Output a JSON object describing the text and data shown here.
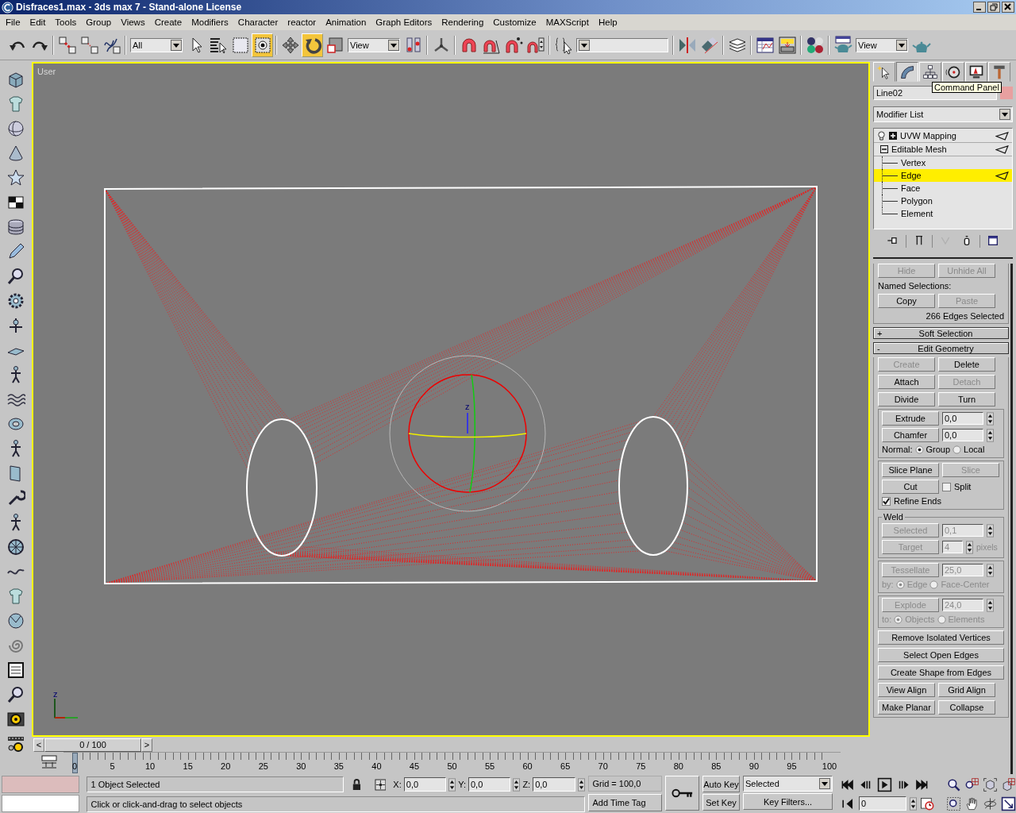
{
  "window": {
    "title": "Disfraces1.max - 3ds max 7  - Stand-alone License"
  },
  "menu": [
    "File",
    "Edit",
    "Tools",
    "Group",
    "Views",
    "Create",
    "Modifiers",
    "Character",
    "reactor",
    "Animation",
    "Graph Editors",
    "Rendering",
    "Customize",
    "MAXScript",
    "Help"
  ],
  "toolbar": [
    {
      "kind": "undo",
      "active": false
    },
    {
      "kind": "redo",
      "active": false
    },
    {
      "kind": "sep"
    },
    {
      "kind": "link",
      "active": false
    },
    {
      "kind": "unlink",
      "active": false
    },
    {
      "kind": "bind",
      "active": false
    },
    {
      "kind": "sep"
    },
    {
      "kind": "dropdown",
      "value": "All"
    },
    {
      "kind": "select",
      "active": false
    },
    {
      "kind": "select_by_name",
      "active": false
    },
    {
      "kind": "region",
      "active": false
    },
    {
      "kind": "crossing",
      "active": true
    },
    {
      "kind": "sep"
    },
    {
      "kind": "move",
      "active": false
    },
    {
      "kind": "rotate",
      "active": true
    },
    {
      "kind": "scale",
      "active": false
    },
    {
      "kind": "dropdown",
      "value": "View"
    },
    {
      "kind": "pivot",
      "active": false
    },
    {
      "kind": "sep"
    },
    {
      "kind": "manipulate",
      "active": false
    },
    {
      "kind": "sep"
    },
    {
      "kind": "snap",
      "active": false
    },
    {
      "kind": "angle_snap",
      "active": false
    },
    {
      "kind": "percent_snap",
      "active": false
    },
    {
      "kind": "spinner_snap",
      "active": false
    },
    {
      "kind": "sep"
    },
    {
      "kind": "edit_named",
      "active": false
    },
    {
      "kind": "dropdown"
    },
    {
      "kind": "sep"
    },
    {
      "kind": "mirror",
      "active": false
    },
    {
      "kind": "align",
      "active": false
    },
    {
      "kind": "sep"
    },
    {
      "kind": "layers",
      "active": false
    },
    {
      "kind": "sep"
    },
    {
      "kind": "curve_editor",
      "active": false
    },
    {
      "kind": "schematic",
      "active": false
    },
    {
      "kind": "sep"
    },
    {
      "kind": "material",
      "active": false
    },
    {
      "kind": "sep"
    },
    {
      "kind": "render_scene",
      "active": false
    },
    {
      "kind": "dropdown",
      "value": "View"
    },
    {
      "kind": "quick_render",
      "active": false
    }
  ],
  "viewport": {
    "label": "User",
    "gizmo_axis": "z",
    "tripod_axis": "z"
  },
  "time_slider": {
    "prev": "<",
    "position": "0 / 100",
    "next": ">",
    "level": 0
  },
  "track_bar": {
    "ticks": [
      "0",
      "5",
      "10",
      "15",
      "20",
      "25",
      "30",
      "35",
      "40",
      "45",
      "50",
      "55",
      "60",
      "65",
      "70",
      "75",
      "80",
      "85",
      "90",
      "95",
      "100"
    ]
  },
  "command_panel": {
    "tabs": [
      {
        "kind": "create",
        "selected": false
      },
      {
        "kind": "modify",
        "selected": true
      },
      {
        "kind": "hierarchy",
        "selected": false
      },
      {
        "kind": "motion",
        "selected": false
      },
      {
        "kind": "display",
        "selected": false
      },
      {
        "kind": "utilities",
        "selected": false
      }
    ],
    "tooltip": "Command Panel",
    "object_name": "Line02",
    "modifier_list": "Modifier List",
    "stack": [
      {
        "label": "UVW Mapping",
        "expanded": false
      },
      {
        "label": "Editable Mesh",
        "expanded": true,
        "children": [
          {
            "label": "Vertex",
            "selected": false
          },
          {
            "label": "Edge",
            "selected": true
          },
          {
            "label": "Face",
            "selected": false
          },
          {
            "label": "Polygon",
            "selected": false
          },
          {
            "label": "Element",
            "selected": false
          }
        ]
      }
    ],
    "stack_tools": [
      {
        "kind": "pin",
        "disabled": false
      },
      {
        "kind": "end_result",
        "disabled": false
      },
      {
        "kind": "unique",
        "disabled": true
      },
      {
        "kind": "remove",
        "disabled": false
      },
      {
        "kind": "configure",
        "disabled": false
      }
    ],
    "rollouts": [
      {
        "groups": [
          {
            "framed": false,
            "rows": [
              {
                "kind": "buttons",
                "buttons": [
                  {
                    "label": "Hide",
                    "disabled": true
                  },
                  {
                    "label": "Unhide All",
                    "disabled": true
                  }
                ]
              },
              {
                "kind": "heading",
                "text": "Named Selections:"
              },
              {
                "kind": "buttons",
                "buttons": [
                  {
                    "label": "Copy",
                    "disabled": false
                  },
                  {
                    "label": "Paste",
                    "disabled": true
                  }
                ]
              },
              {
                "kind": "status",
                "text": "266 Edges Selected"
              }
            ]
          }
        ]
      },
      {
        "sign": "+",
        "header": "Soft Selection"
      },
      {
        "sign": "-",
        "header": "Edit Geometry",
        "groups": [
          {
            "framed": false,
            "rows": [
              {
                "kind": "buttons",
                "buttons": [
                  {
                    "label": "Create",
                    "disabled": true
                  },
                  {
                    "label": "Delete",
                    "disabled": false
                  }
                ]
              },
              {
                "kind": "buttons",
                "buttons": [
                  {
                    "label": "Attach",
                    "disabled": false
                  },
                  {
                    "label": "Detach",
                    "disabled": true
                  }
                ]
              },
              {
                "kind": "buttons",
                "buttons": [
                  {
                    "label": "Divide",
                    "disabled": false
                  },
                  {
                    "label": "Turn",
                    "disabled": false
                  }
                ]
              }
            ]
          },
          {
            "framed": true,
            "rows": [
              {
                "kind": "spinner",
                "button": {
                  "label": "Extrude",
                  "disabled": false
                },
                "value": "0,0"
              },
              {
                "kind": "spinner",
                "button": {
                  "label": "Chamfer",
                  "disabled": false
                },
                "value": "0,0"
              },
              {
                "kind": "radios",
                "label": "Normal:",
                "disabled": false,
                "options": [
                  {
                    "label": "Group",
                    "selected": true
                  },
                  {
                    "label": "Local",
                    "selected": false
                  }
                ]
              }
            ]
          },
          {
            "framed": true,
            "rows": [
              {
                "kind": "buttons",
                "buttons": [
                  {
                    "label": "Slice Plane",
                    "disabled": false
                  },
                  {
                    "label": "Slice",
                    "disabled": true
                  }
                ]
              },
              {
                "kind": "button_check",
                "button": {
                  "label": "Cut",
                  "disabled": false
                },
                "check": {
                  "label": "Split",
                  "checked": false
                }
              },
              {
                "kind": "check",
                "label": "Refine Ends",
                "checked": true
              }
            ]
          },
          {
            "framed": true,
            "title": "Weld",
            "rows": [
              {
                "kind": "spinner",
                "button": {
                  "label": "Selected",
                  "disabled": true
                },
                "value": "0,1"
              },
              {
                "kind": "spinner",
                "button": {
                  "label": "Target",
                  "disabled": true
                },
                "value": "4",
                "unit": "pixels"
              }
            ]
          },
          {
            "framed": true,
            "rows": [
              {
                "kind": "spinner",
                "button": {
                  "label": "Tessellate",
                  "disabled": true
                },
                "value": "25,0"
              },
              {
                "kind": "radios",
                "label": "by:",
                "disabled": true,
                "options": [
                  {
                    "label": "Edge",
                    "selected": true
                  },
                  {
                    "label": "Face-Center",
                    "selected": false
                  }
                ]
              }
            ]
          },
          {
            "framed": true,
            "rows": [
              {
                "kind": "spinner",
                "button": {
                  "label": "Explode",
                  "disabled": true
                },
                "value": "24,0"
              },
              {
                "kind": "radios",
                "label": "to:",
                "disabled": true,
                "options": [
                  {
                    "label": "Objects",
                    "selected": true
                  },
                  {
                    "label": "Elements",
                    "selected": false
                  }
                ]
              }
            ]
          },
          {
            "framed": false,
            "rows": [
              {
                "kind": "buttons",
                "buttons": [
                  {
                    "label": "Remove Isolated Vertices",
                    "disabled": false
                  }
                ]
              },
              {
                "kind": "buttons",
                "buttons": [
                  {
                    "label": "Select Open Edges",
                    "disabled": false
                  }
                ]
              },
              {
                "kind": "buttons",
                "buttons": [
                  {
                    "label": "Create Shape from Edges",
                    "disabled": false
                  }
                ]
              },
              {
                "kind": "buttons",
                "buttons": [
                  {
                    "label": "View Align",
                    "disabled": false
                  },
                  {
                    "label": "Grid Align",
                    "disabled": false
                  }
                ]
              },
              {
                "kind": "buttons",
                "buttons": [
                  {
                    "label": "Make Planar",
                    "disabled": false
                  },
                  {
                    "label": "Collapse",
                    "disabled": false
                  }
                ]
              }
            ]
          }
        ]
      }
    ]
  },
  "status": {
    "selection": "1 Object Selected",
    "prompt": "Click or click-and-drag to select objects",
    "coords": [
      {
        "axis": "X:",
        "value": "0,0"
      },
      {
        "axis": "Y:",
        "value": "0,0"
      },
      {
        "axis": "Z:",
        "value": "0,0"
      }
    ],
    "grid": "Grid = 100,0",
    "time_tag": "Add Time Tag",
    "auto_key": "Auto Key",
    "set_key": "Set Key",
    "key_mode": "Selected",
    "key_filters": "Key Filters...",
    "frame": "0"
  }
}
